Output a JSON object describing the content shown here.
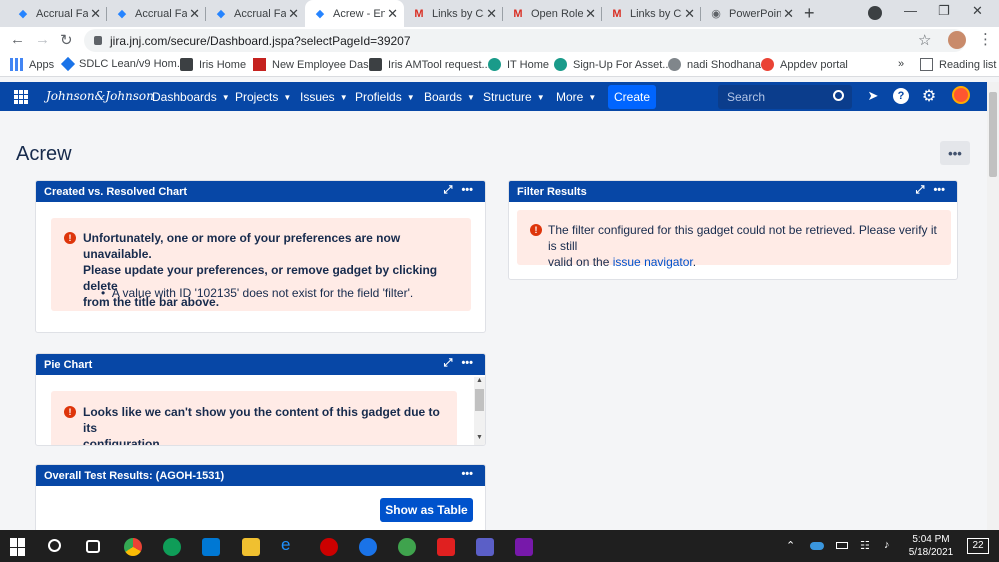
{
  "browser": {
    "tabs": [
      {
        "title": "Accrual Fac",
        "icon": "jira-icon",
        "active": false
      },
      {
        "title": "Accrual Fac",
        "icon": "jira-icon",
        "active": false
      },
      {
        "title": "Accrual Fac",
        "icon": "jira-icon",
        "active": false
      },
      {
        "title": "Acrew - Ent",
        "icon": "jira-icon",
        "active": true
      },
      {
        "title": "Links by Ca",
        "icon": "gmail-icon",
        "active": false
      },
      {
        "title": "Open Roles",
        "icon": "gmail-icon",
        "active": false
      },
      {
        "title": "Links by Ca",
        "icon": "gmail-icon",
        "active": false
      },
      {
        "title": "PowerPoint",
        "icon": "globe-icon",
        "active": false
      }
    ],
    "new_tab": "+",
    "url": "jira.jnj.com/secure/Dashboard.jspa?selectPageId=39207",
    "bookmarks": [
      {
        "label": "Apps"
      },
      {
        "label": "SDLC Lean/v9 Hom..."
      },
      {
        "label": "Iris Home"
      },
      {
        "label": "New Employee Das..."
      },
      {
        "label": "Iris AMTool request..."
      },
      {
        "label": "IT Home"
      },
      {
        "label": "Sign-Up For Asset..."
      },
      {
        "label": "nadi Shodhana"
      },
      {
        "label": "Appdev portal"
      },
      {
        "label": "Reading list"
      }
    ],
    "overflow": "»"
  },
  "header": {
    "logo": "Johnson&Johnson",
    "nav": [
      "Dashboards",
      "Projects",
      "Issues",
      "Profields",
      "Boards",
      "Structure",
      "More"
    ],
    "create_label": "Create",
    "search_placeholder": "Search"
  },
  "page": {
    "title": "Acrew",
    "tools_label": "•••"
  },
  "gadgets": {
    "created_resolved": {
      "title": "Created vs. Resolved Chart",
      "message_line1": "Unfortunately, one or more of your preferences are now unavailable.",
      "message_line2": "Please update your preferences, or remove gadget by clicking delete",
      "message_line3": "from the title bar above.",
      "bullet": "A value with ID '102135' does not exist for the field 'filter'."
    },
    "filter_results": {
      "title": "Filter Results",
      "message_line1": "The filter configured for this gadget could not be retrieved. Please verify it is still",
      "message_prefix": "valid on the ",
      "message_link": "issue navigator",
      "message_suffix": "."
    },
    "pie_chart": {
      "title": "Pie Chart",
      "message_line1": "Looks like we can't show you the content of this gadget due to its",
      "message_line2": "configuration."
    },
    "overall_test": {
      "title": "Overall Test Results: (AGOH-1531)",
      "button_label": "Show as Table"
    }
  },
  "taskbar": {
    "time": "5:04 PM",
    "date": "5/18/2021",
    "notifications": "22"
  },
  "colors": {
    "jira_header": "#0747a6",
    "create_button": "#0065ff",
    "error_bg": "#ffebe6",
    "error_icon": "#de350b"
  }
}
